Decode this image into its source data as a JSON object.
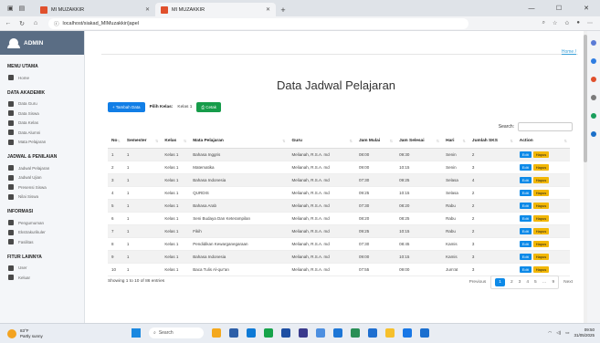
{
  "browser": {
    "tabs": [
      {
        "label": "MI MUZAKKIR"
      },
      {
        "label": "MI MUZAKKIR"
      }
    ],
    "url": "localhost/siakad_MIMuzakkir/japel",
    "new_tab": "+"
  },
  "sidebar": {
    "brand": "ADMIN",
    "sections": [
      {
        "heading": "MENU UTAMA",
        "items": [
          "Home"
        ]
      },
      {
        "heading": "DATA AKADEMIK",
        "items": [
          "Data Guru",
          "Data Siswa",
          "Data Kelas",
          "Data Alumni",
          "Mata Pelajaran"
        ]
      },
      {
        "heading": "JADWAL & PENILAIAN",
        "items": [
          "Jadwal Pelajaran",
          "Jadwal Ujian",
          "Presensi Siswa",
          "Nilai Siswa"
        ]
      },
      {
        "heading": "INFORMASI",
        "items": [
          "Pengumuman",
          "Ekstrakurikuler",
          "Fasilitas"
        ]
      },
      {
        "heading": "FITUR LAINNYA",
        "items": [
          "User",
          "Keluar"
        ]
      }
    ]
  },
  "main": {
    "breadcrumb": "Home /",
    "title": "Data Jadwal Pelajaran",
    "add_button": "+ Tambah Data",
    "filter_label": "Pilih Kelas:",
    "filter_value": "Kelas 1",
    "print_button": "Cetak",
    "search_label": "Search:",
    "columns": [
      "No",
      "Semester",
      "Kelas",
      "Mata Pelajaran",
      "Guru",
      "Jam Mulai",
      "Jam Selesai",
      "Hari",
      "Jumlah SKS",
      "Action"
    ],
    "rows": [
      [
        "1",
        "1",
        "Kelas 1",
        "Bahasa Inggris",
        "Melianah, R.S.A. md",
        "08:00",
        "09:30",
        "Senin",
        "2"
      ],
      [
        "2",
        "1",
        "Kelas 1",
        "Matematika",
        "Melianah, R.S.A. md",
        "09:00",
        "10:15",
        "Senin",
        "3"
      ],
      [
        "3",
        "1",
        "Kelas 1",
        "Bahasa Indonesia",
        "Melianah, R.S.A. md",
        "07:30",
        "09:25",
        "Selasa",
        "4"
      ],
      [
        "4",
        "1",
        "Kelas 1",
        "QURDIS",
        "Melianah, R.S.A. md",
        "09:25",
        "10:15",
        "Selasa",
        "2"
      ],
      [
        "5",
        "1",
        "Kelas 1",
        "Bahasa Arab",
        "Melianah, R.S.A. md",
        "07:30",
        "08:20",
        "Rabu",
        "2"
      ],
      [
        "6",
        "1",
        "Kelas 1",
        "Seni Budaya Dan Keterampilan",
        "Melianah, R.S.A. md",
        "08:20",
        "08:25",
        "Rabu",
        "2"
      ],
      [
        "7",
        "1",
        "Kelas 1",
        "Fikih",
        "Melianah, R.S.A. md",
        "09:25",
        "10:15",
        "Rabu",
        "2"
      ],
      [
        "8",
        "1",
        "Kelas 1",
        "Pendidikan Kewarganegaraan",
        "Melianah, R.S.A. md",
        "07:30",
        "08:45",
        "Kamis",
        "3"
      ],
      [
        "9",
        "1",
        "Kelas 1",
        "Bahasa Indonesia",
        "Melianah, R.S.A. md",
        "09:00",
        "10:15",
        "Kamis",
        "3"
      ],
      [
        "10",
        "1",
        "Kelas 1",
        "Baca Tulis Al-qur'an",
        "Melianah, R.S.A. md",
        "07:55",
        "09:00",
        "Jum'at",
        "3"
      ]
    ],
    "edit_label": "Edit",
    "delete_label": "Hapus",
    "info": "Showing 1 to 10 of 86 entries",
    "pager": {
      "prev": "Previous",
      "pages": [
        "1",
        "2",
        "3",
        "4",
        "5",
        "…",
        "9"
      ],
      "next": "Next"
    }
  },
  "taskbar": {
    "weather_temp": "83°F",
    "weather_desc": "Partly sunny",
    "search": "Search",
    "time": "09:50",
    "date": "31/05/2025"
  }
}
